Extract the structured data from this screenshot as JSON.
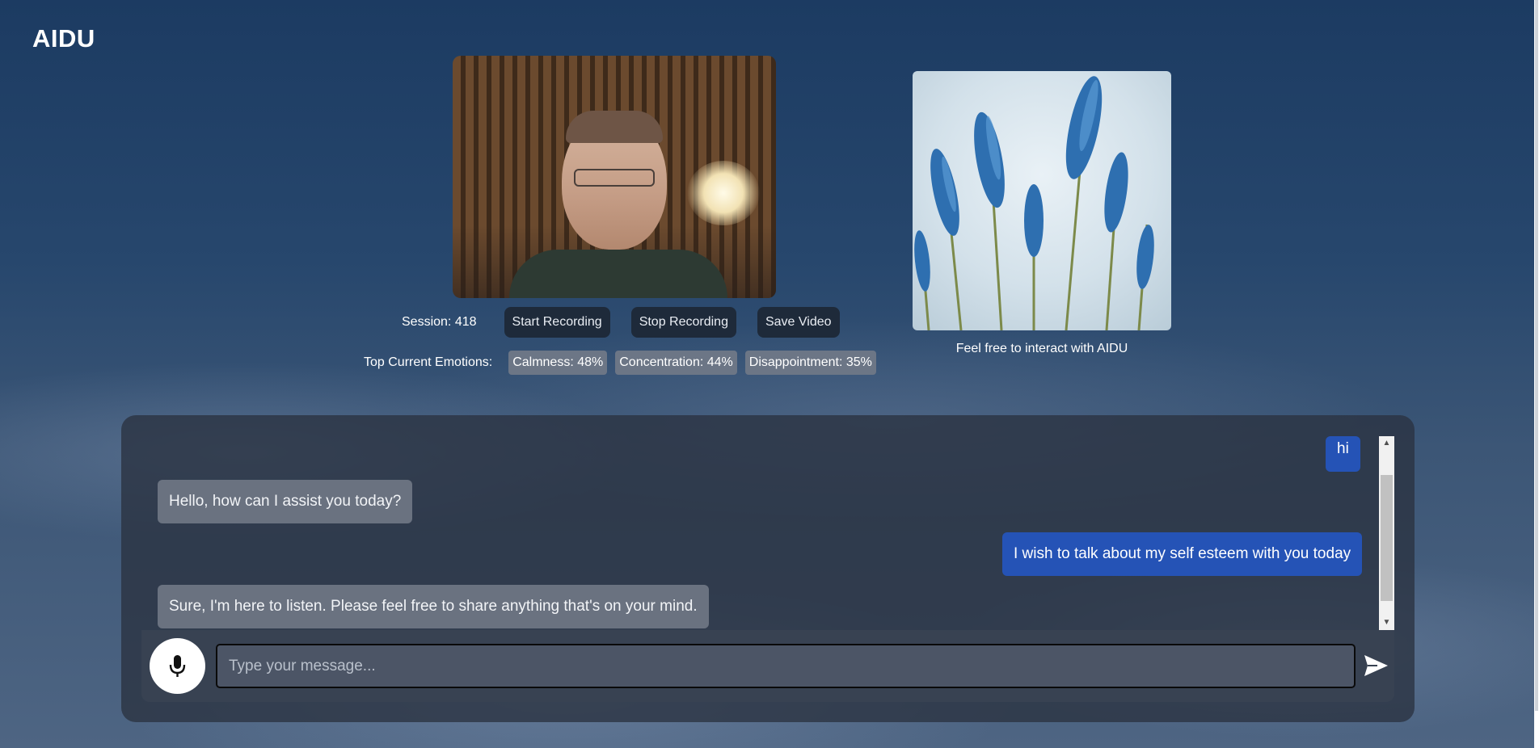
{
  "app": {
    "brand": "AIDU"
  },
  "session": {
    "label": "Session: 418"
  },
  "controls": {
    "start_label": "Start Recording",
    "stop_label": "Stop Recording",
    "save_label": "Save Video"
  },
  "emotions": {
    "label": "Top Current Emotions:",
    "items": [
      "Calmness: 48%",
      "Concentration: 44%",
      "Disappointment: 35%"
    ]
  },
  "avatar": {
    "caption": "Feel free to interact with AIDU"
  },
  "chat": {
    "messages": [
      {
        "role": "user",
        "text": "hi"
      },
      {
        "role": "bot",
        "text": "Hello, how can I assist you today?"
      },
      {
        "role": "user",
        "text": "I wish to talk about my self esteem with you today"
      },
      {
        "role": "bot",
        "text": "Sure, I'm here to listen. Please feel free to share anything that's on your mind."
      }
    ],
    "input_placeholder": "Type your message...",
    "mic_icon": "microphone-icon",
    "send_icon": "send-icon"
  },
  "colors": {
    "user_bubble": "#2553b6",
    "bot_bubble": "#6a7280",
    "panel": "#2a3240"
  }
}
